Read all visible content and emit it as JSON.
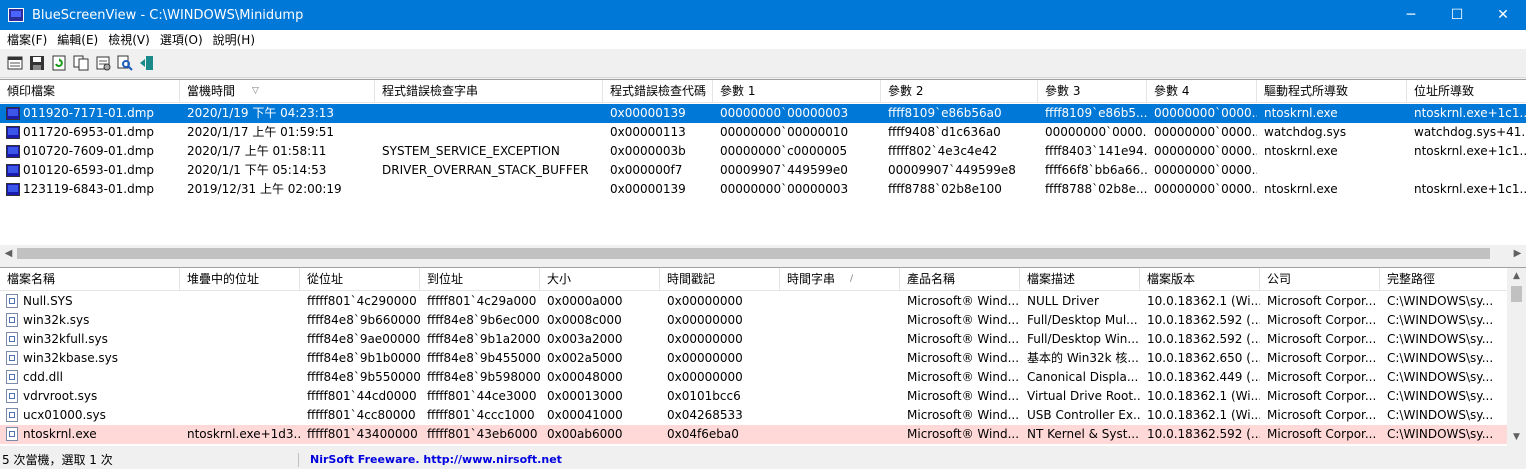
{
  "window": {
    "title": "BlueScreenView  -  C:\\WINDOWS\\Minidump",
    "minimize": "─",
    "maximize": "☐",
    "close": "✕"
  },
  "menu": [
    "檔案(F)",
    "編輯(E)",
    "檢視(V)",
    "選項(O)",
    "說明(H)"
  ],
  "toolbar_icons": [
    "html-report-icon",
    "save-icon",
    "refresh-icon",
    "copy-icon",
    "properties-icon",
    "find-icon",
    "exit-icon"
  ],
  "top": {
    "headers": [
      "傾印檔案",
      "當機時間",
      "程式錯誤檢查字串",
      "程式錯誤檢查代碼",
      "參數 1",
      "參數 2",
      "參數 3",
      "參數 4",
      "驅動程式所導致",
      "位址所導致"
    ],
    "rows": [
      [
        "011920-7171-01.dmp",
        "2020/1/19 下午 04:23:13",
        "",
        "0x00000139",
        "00000000`00000003",
        "ffff8109`e86b56a0",
        "ffff8109`e86b5...",
        "00000000`0000...",
        "ntoskrnl.exe",
        "ntoskrnl.exe+1c1..."
      ],
      [
        "011720-6953-01.dmp",
        "2020/1/17 上午 01:59:51",
        "",
        "0x00000113",
        "00000000`00000010",
        "ffff9408`d1c636a0",
        "00000000`0000...",
        "00000000`0000...",
        "watchdog.sys",
        "watchdog.sys+41..."
      ],
      [
        "010720-7609-01.dmp",
        "2020/1/7 上午 01:58:11",
        "SYSTEM_SERVICE_EXCEPTION",
        "0x0000003b",
        "00000000`c0000005",
        "fffff802`4e3c4e42",
        "ffff8403`141e94...",
        "00000000`0000...",
        "ntoskrnl.exe",
        "ntoskrnl.exe+1c1..."
      ],
      [
        "010120-6593-01.dmp",
        "2020/1/1 下午 05:14:53",
        "DRIVER_OVERRAN_STACK_BUFFER",
        "0x000000f7",
        "00009907`449599e0",
        "00009907`449599e8",
        "ffff66f8`bb6a66...",
        "00000000`0000...",
        "",
        ""
      ],
      [
        "123119-6843-01.dmp",
        "2019/12/31 上午 02:00:19",
        "",
        "0x00000139",
        "00000000`00000003",
        "ffff8788`02b8e100",
        "ffff8788`02b8e...",
        "00000000`0000...",
        "ntoskrnl.exe",
        "ntoskrnl.exe+1c1..."
      ]
    ]
  },
  "bottom": {
    "headers": [
      "檔案名稱",
      "堆疊中的位址",
      "從位址",
      "到位址",
      "大小",
      "時間戳記",
      "時間字串",
      "產品名稱",
      "檔案描述",
      "檔案版本",
      "公司",
      "完整路徑"
    ],
    "rows": [
      [
        "Null.SYS",
        "",
        "fffff801`4c290000",
        "fffff801`4c29a000",
        "0x0000a000",
        "0x00000000",
        "",
        "Microsoft® Wind...",
        "NULL Driver",
        "10.0.18362.1 (Wi...",
        "Microsoft Corpor...",
        "C:\\WINDOWS\\sy..."
      ],
      [
        "win32k.sys",
        "",
        "ffff84e8`9b660000",
        "ffff84e8`9b6ec000",
        "0x0008c000",
        "0x00000000",
        "",
        "Microsoft® Wind...",
        "Full/Desktop Mul...",
        "10.0.18362.592 (...",
        "Microsoft Corpor...",
        "C:\\WINDOWS\\sy..."
      ],
      [
        "win32kfull.sys",
        "",
        "ffff84e8`9ae00000",
        "ffff84e8`9b1a2000",
        "0x003a2000",
        "0x00000000",
        "",
        "Microsoft® Wind...",
        "Full/Desktop Win...",
        "10.0.18362.592 (...",
        "Microsoft Corpor...",
        "C:\\WINDOWS\\sy..."
      ],
      [
        "win32kbase.sys",
        "",
        "ffff84e8`9b1b0000",
        "ffff84e8`9b455000",
        "0x002a5000",
        "0x00000000",
        "",
        "Microsoft® Wind...",
        "基本的 Win32k 核...",
        "10.0.18362.650 (...",
        "Microsoft Corpor...",
        "C:\\WINDOWS\\sy..."
      ],
      [
        "cdd.dll",
        "",
        "ffff84e8`9b550000",
        "ffff84e8`9b598000",
        "0x00048000",
        "0x00000000",
        "",
        "Microsoft® Wind...",
        "Canonical Displa...",
        "10.0.18362.449 (...",
        "Microsoft Corpor...",
        "C:\\WINDOWS\\sy..."
      ],
      [
        "vdrvroot.sys",
        "",
        "fffff801`44cd0000",
        "fffff801`44ce3000",
        "0x00013000",
        "0x0101bcc6",
        "",
        "Microsoft® Wind...",
        "Virtual Drive Root...",
        "10.0.18362.1 (Wi...",
        "Microsoft Corpor...",
        "C:\\WINDOWS\\sy..."
      ],
      [
        "ucx01000.sys",
        "",
        "fffff801`4cc80000",
        "fffff801`4ccc1000",
        "0x00041000",
        "0x04268533",
        "",
        "Microsoft® Wind...",
        "USB Controller Ex...",
        "10.0.18362.1 (Wi...",
        "Microsoft Corpor...",
        "C:\\WINDOWS\\sy..."
      ],
      [
        "ntoskrnl.exe",
        "ntoskrnl.exe+1d3...",
        "fffff801`43400000",
        "fffff801`43eb6000",
        "0x00ab6000",
        "0x04f6eba0",
        "",
        "Microsoft® Wind...",
        "NT Kernel & Syst...",
        "10.0.18362.592 (...",
        "Microsoft Corpor...",
        "C:\\WINDOWS\\sy..."
      ]
    ]
  },
  "status": {
    "left": "5 次當機，選取 1 次",
    "link": "NirSoft Freeware.  http://www.nirsoft.net"
  },
  "colors": {
    "titlebar": "#0078d7",
    "selection": "#0078d7",
    "highlight_row": "#ffd8d8",
    "link": "#0000e0"
  }
}
